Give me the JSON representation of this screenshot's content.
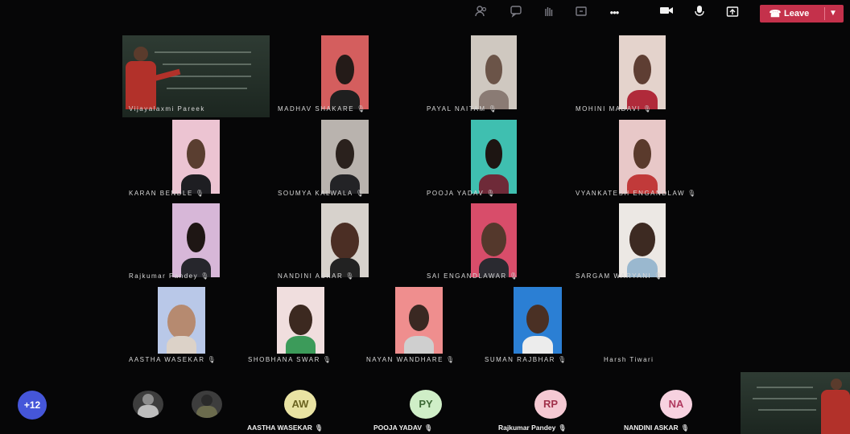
{
  "toolbar": {
    "icons": [
      "people-icon",
      "chat-icon",
      "raise-hand-icon",
      "share-tray-icon",
      "more-options-icon",
      "camera-icon",
      "microphone-icon",
      "share-icon"
    ],
    "more_label": "•••",
    "leave_label": "Leave"
  },
  "participants": [
    {
      "name": "Vijayalaxmi Pareek"
    },
    {
      "name": "MADHAV SHAKARE"
    },
    {
      "name": "PAYAL NAITAM"
    },
    {
      "name": "MOHINI MADAVI"
    },
    {
      "name": "KARAN BENDLE"
    },
    {
      "name": "SOUMYA KALWALA"
    },
    {
      "name": "POOJA YADAV"
    },
    {
      "name": "VYANKATESH ENGANDLAW"
    },
    {
      "name": "Rajkumar Pandey"
    },
    {
      "name": "NANDINI ASKAR"
    },
    {
      "name": "SAI ENGANDLAWAR"
    },
    {
      "name": "SARGAM WARYANI"
    },
    {
      "name": "AASTHA WASEKAR"
    },
    {
      "name": "SHOBHANA SWAR"
    },
    {
      "name": "NAYAN WANDHARE"
    },
    {
      "name": "SUMAN RAJBHAR"
    },
    {
      "name": "Harsh Tiwari"
    }
  ],
  "bottom_strip": {
    "more_count": "+12",
    "people": [
      {
        "initials": "AW",
        "name": "AASTHA WASEKAR",
        "bg": "#e9e3a3",
        "fg": "#6b6320"
      },
      {
        "initials": "PY",
        "name": "POOJA YADAV",
        "bg": "#cfeec7",
        "fg": "#3d6a36"
      },
      {
        "initials": "RP",
        "name": "Rajkumar Pandey",
        "bg": "#f5c9d3",
        "fg": "#a0304a"
      },
      {
        "initials": "NA",
        "name": "NANDINI ASKAR",
        "bg": "#f7d2e0",
        "fg": "#b0395f"
      }
    ]
  },
  "colors": {
    "leave_button": "#c4314b",
    "more_avatar": "#4556d9",
    "background": "#060607"
  }
}
